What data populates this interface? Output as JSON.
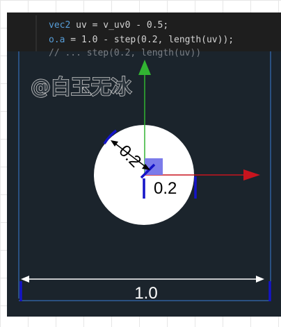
{
  "code": {
    "line1_type": "vec2",
    "line1_rest": " uv = v_uv0 - 0.5;",
    "line2_var": "o.a",
    "line2_rest": " = 1.0 - step(0.2, length(uv));",
    "line3_ghost": "// ... step(0.2, length(uv))"
  },
  "watermark": "@白玉无冰",
  "labels": {
    "radius_diagonal": "0.2",
    "radius_horizontal": "0.2",
    "width": "1.0"
  },
  "colors": {
    "panel_bg": "#1b242c",
    "code_bg": "#1e1e1e",
    "circle": "#ffffff",
    "x_axis": "#c8141e",
    "y_axis": "#32b432",
    "marker": "#1414c8",
    "origin_square": "#7b7bea"
  }
}
